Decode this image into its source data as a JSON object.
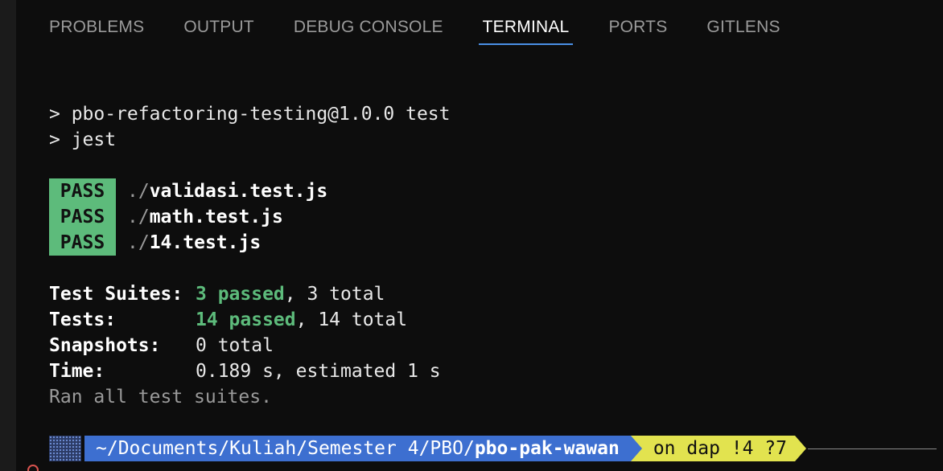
{
  "tabs": [
    {
      "label": "PROBLEMS"
    },
    {
      "label": "OUTPUT"
    },
    {
      "label": "DEBUG CONSOLE"
    },
    {
      "label": "TERMINAL",
      "active": true
    },
    {
      "label": "PORTS"
    },
    {
      "label": "GITLENS"
    }
  ],
  "terminal": {
    "cmd_line_1": "> pbo-refactoring-testing@1.0.0 test",
    "cmd_line_2": "> jest",
    "results": [
      {
        "status": "PASS",
        "dir": "./",
        "file": "validasi.test.js"
      },
      {
        "status": "PASS",
        "dir": "./",
        "file": "math.test.js"
      },
      {
        "status": "PASS",
        "dir": "./",
        "file": "14.test.js"
      }
    ],
    "summary": {
      "suites_label": "Test Suites:",
      "suites_passed": "3 passed",
      "suites_total": ", 3 total",
      "tests_label": "Tests:",
      "tests_passed": "14 passed",
      "tests_total": ", 14 total",
      "snapshots_label": "Snapshots:",
      "snapshots_value": "0 total",
      "time_label": "Time:",
      "time_value": "0.189 s, estimated 1 s"
    },
    "ran_all": "Ran all test suites."
  },
  "prompt": {
    "path_prefix": "~/Documents/Kuliah/Semester 4/PBO/",
    "path_dir": "pbo-pak-wawan",
    "git": "on dap !4 ?7"
  },
  "colors": {
    "accent": "#4a8fe6",
    "pass": "#5dbb7b",
    "prompt_path_bg": "#3d6fd0",
    "prompt_git_bg": "#e2e34f"
  }
}
